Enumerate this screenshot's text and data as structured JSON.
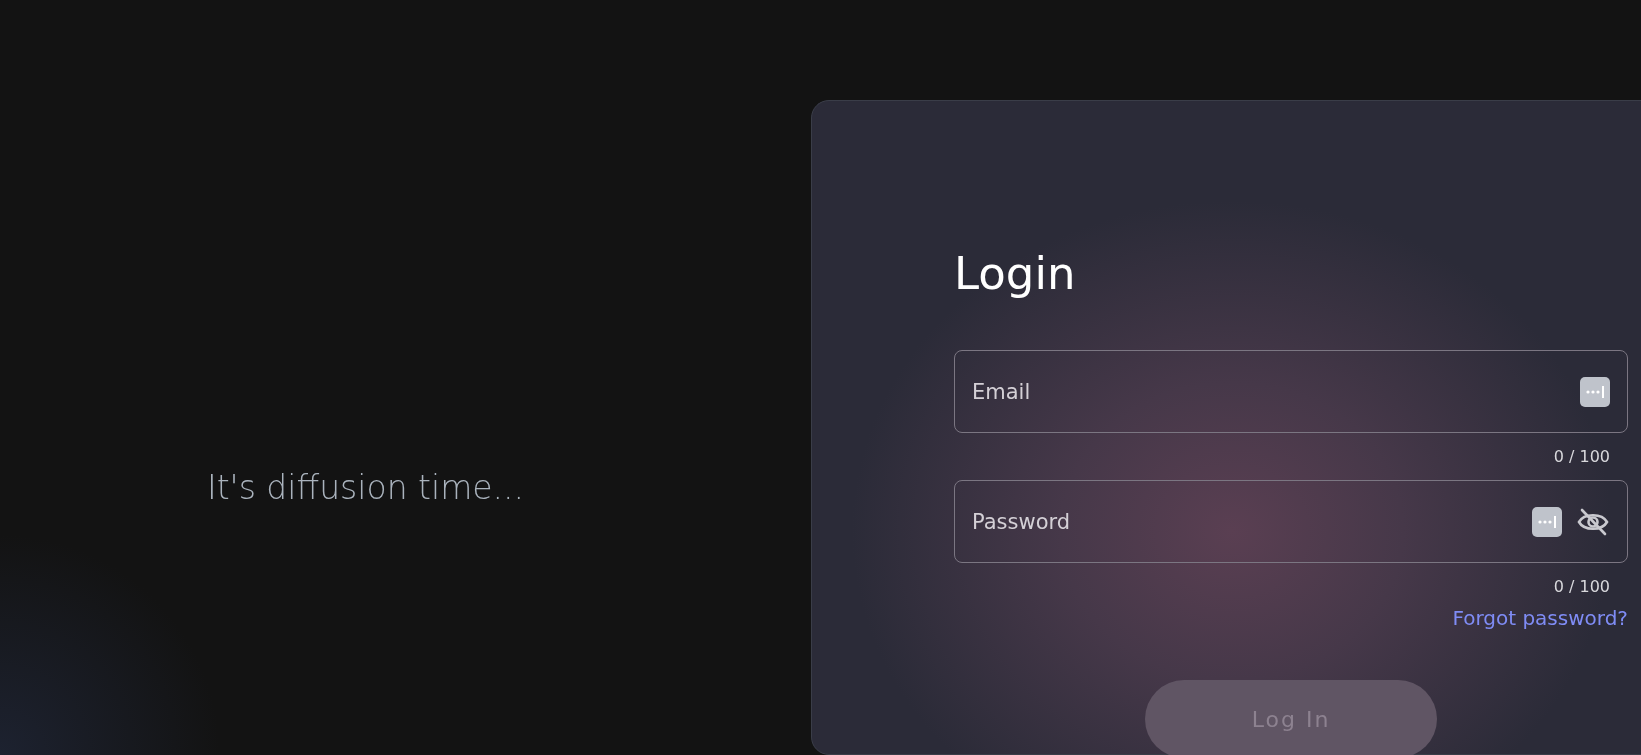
{
  "tagline": "It's diffusion time...",
  "login": {
    "title": "Login",
    "fields": [
      {
        "kind": "email",
        "placeholder": "Email",
        "counter": "0 / 100"
      },
      {
        "kind": "password",
        "placeholder": "Password",
        "counter": "0 / 100",
        "password_visible": false
      }
    ],
    "forgot_link": "Forgot password?",
    "submit": {
      "label": "Log In",
      "disabled": true
    }
  }
}
